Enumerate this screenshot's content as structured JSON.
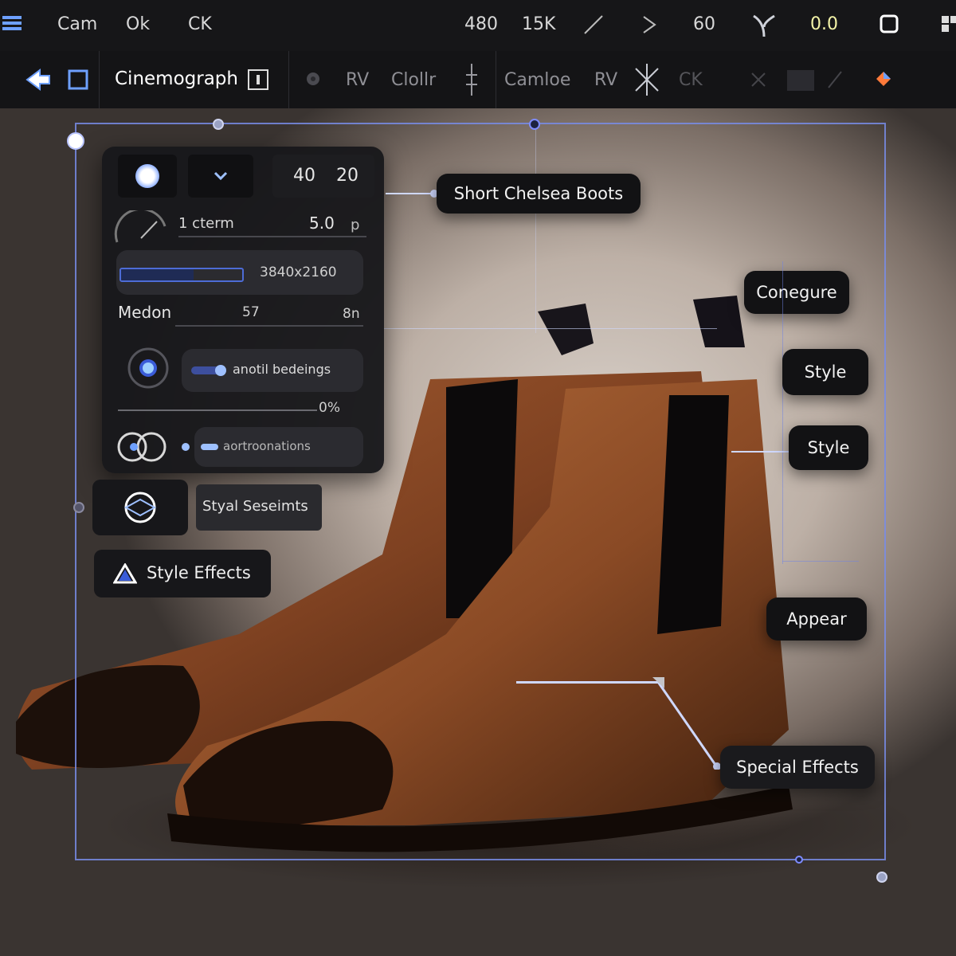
{
  "topbar": {
    "items": [
      "Cam",
      "Ok",
      "CK"
    ],
    "right_items": [
      "480",
      "15K",
      "60",
      "0.0"
    ]
  },
  "toolbar": {
    "title": "Cinemograph",
    "items": [
      "RV",
      "Clollr",
      "Camloe",
      "RV",
      "CK"
    ]
  },
  "panel": {
    "value_a": "40",
    "value_b": "20",
    "row1_label": "1 cterm",
    "row1_value": "5.0",
    "row1_unit": "p",
    "progress_label": "3840x2160",
    "progress_fill": 0.6,
    "motion_label": "Medon",
    "motion_value": "57",
    "motion_unit": "8n",
    "toggle_label": "anotil bedeings",
    "slider_value": "0%",
    "option_label": "aortroonations"
  },
  "buttons": {
    "style_settings": "Styal Seseimts",
    "style_effects": "Style Effects"
  },
  "tags": {
    "product": "Short Chelsea Boots",
    "configure": "Conegure",
    "style1": "Style",
    "style2": "Style",
    "appear": "Appear",
    "special": "Special Effects"
  },
  "colors": {
    "accent": "#7e8cff",
    "panel_bg": "#18181b",
    "leather": "#8a4a25"
  }
}
